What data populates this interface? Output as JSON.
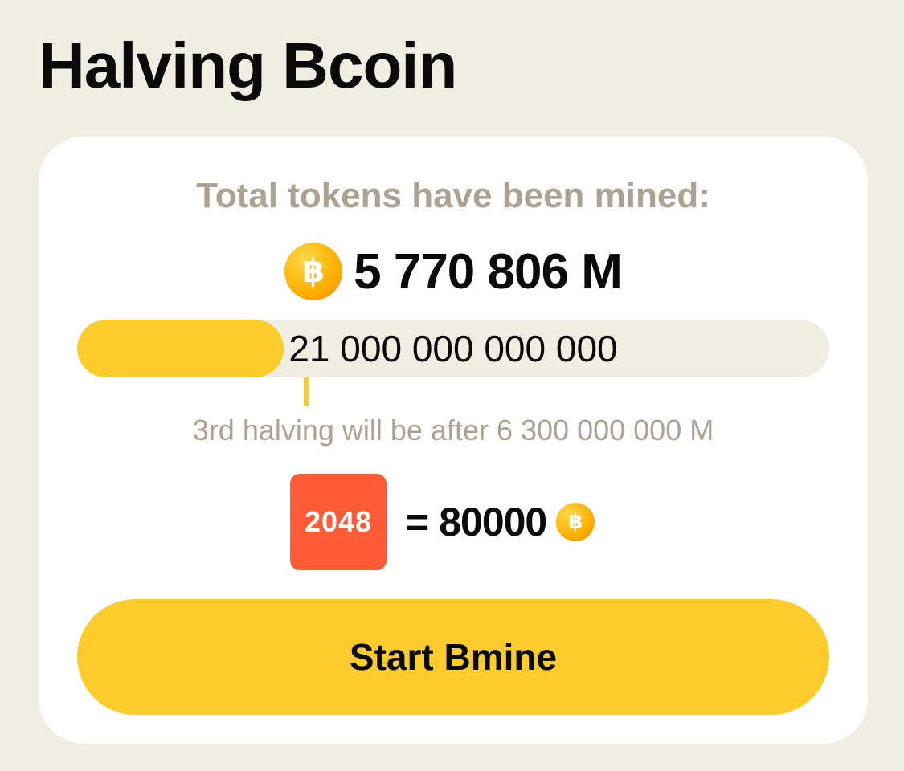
{
  "page": {
    "title": "Halving Bcoin"
  },
  "card": {
    "mined_label": "Total tokens have been mined:",
    "mined_value": "5 770 806 M",
    "coin_icon": "bitcoin-coin-icon",
    "coin_symbol": "฿",
    "progress": {
      "total_label": "21 000 000 000 000",
      "fraction": 0.2748
    },
    "halving_note": "3rd halving will be after 6 300 000 000 M",
    "rate": {
      "tile_label": "2048",
      "equals": "=",
      "value": "80000"
    },
    "start_button_label": "Start Bmine"
  },
  "colors": {
    "background": "#f0ede3",
    "card": "#ffffff",
    "accent_yellow": "#fccd2a",
    "muted_text": "#aba294",
    "tile_orange": "#ff5c35",
    "coin_gold": "#ffb300"
  }
}
